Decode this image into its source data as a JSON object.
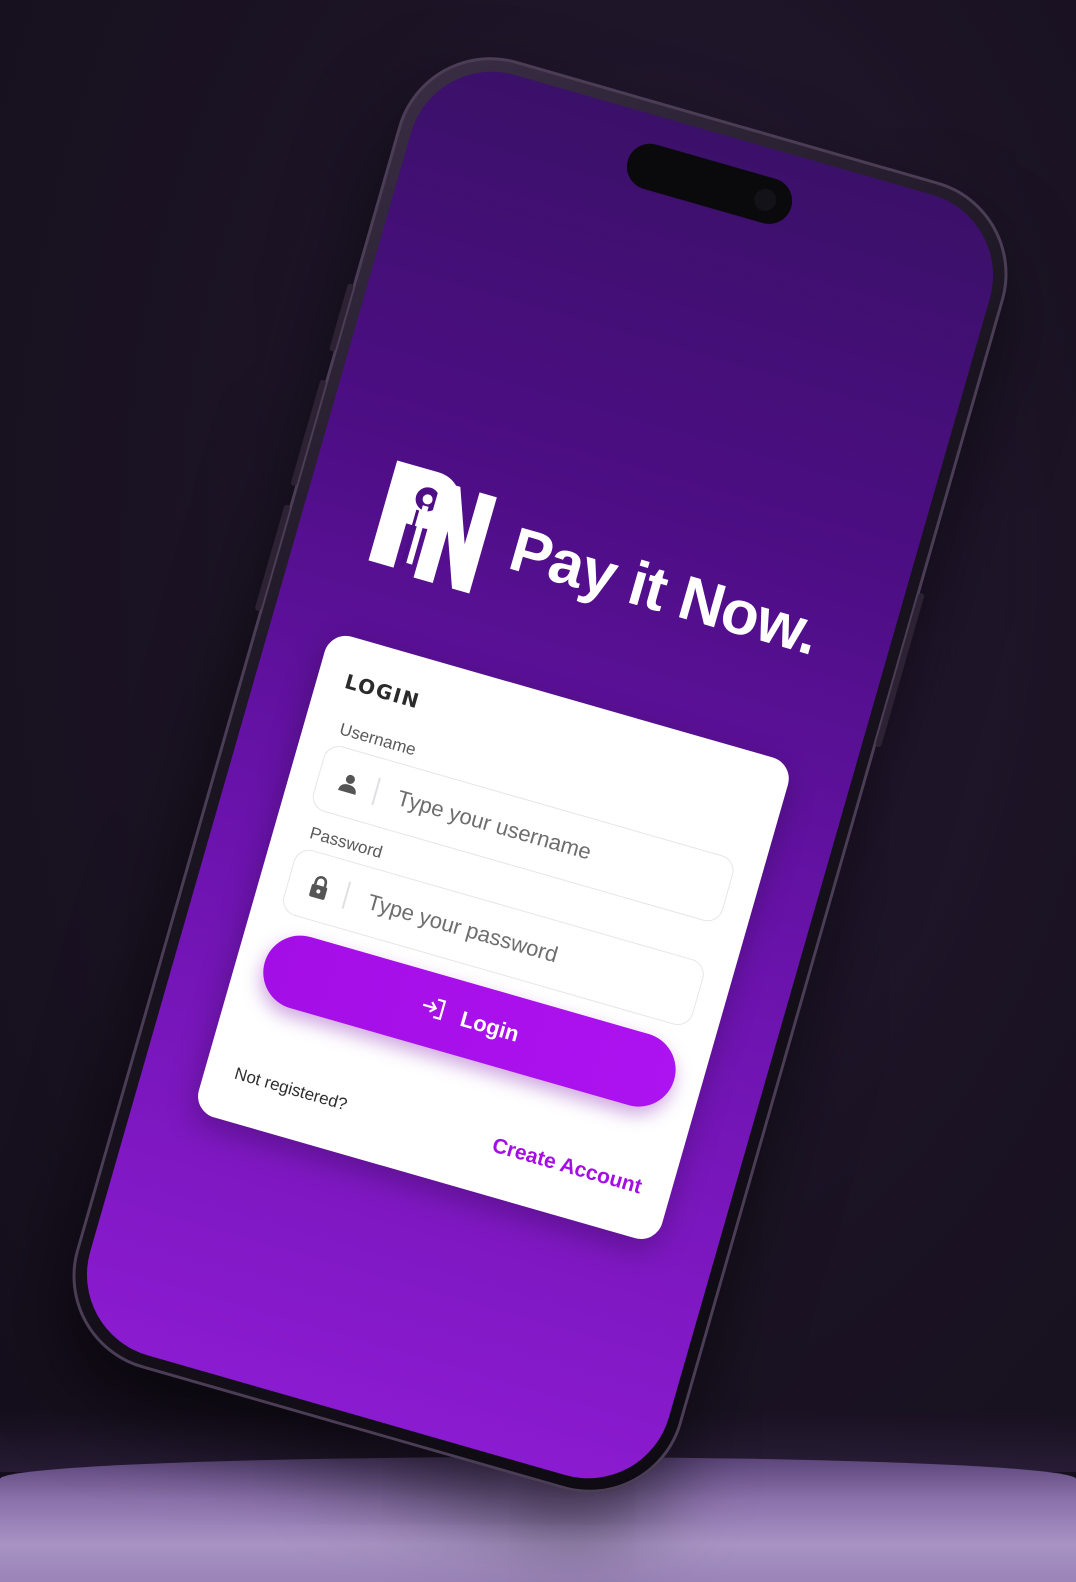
{
  "app": {
    "brand_name": "Pay it Now.",
    "logo_letters": "PN"
  },
  "login_card": {
    "title": "LOGIN",
    "username_label": "Username",
    "username_placeholder": "Type your username",
    "password_label": "Password",
    "password_placeholder": "Type your password",
    "login_button_label": "Login",
    "not_registered_text": "Not registered?",
    "create_account_label": "Create Account"
  },
  "icons": {
    "username": "user-icon",
    "password": "lock-icon",
    "login": "login-arrow-icon"
  },
  "colors": {
    "accent": "#a40ee6",
    "screen_top": "#3b1069",
    "screen_bottom": "#8b1bd0",
    "background": "#1c1425"
  }
}
